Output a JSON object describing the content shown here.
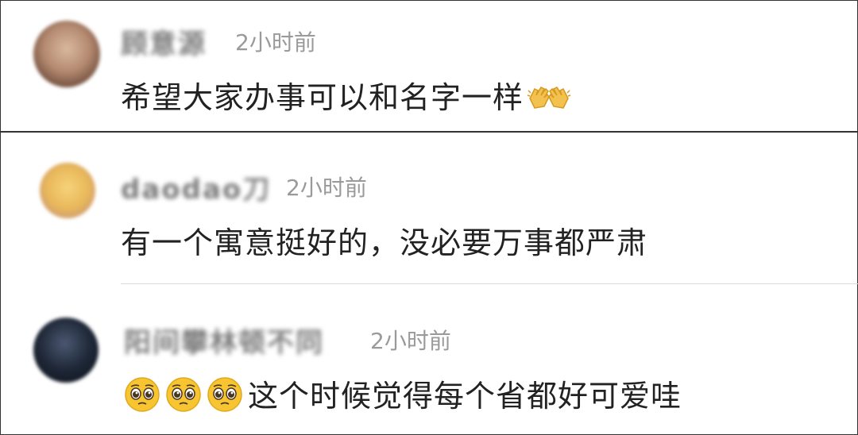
{
  "comments": [
    {
      "username": "顾意源",
      "time": "2小时前",
      "text": "希望大家办事可以和名字一样",
      "trailing_icon": "open-hands-icon"
    },
    {
      "username": "daodao刀",
      "time": "2小时前",
      "text": "有一个寓意挺好的，没必要万事都严肃"
    },
    {
      "username": "阳间攀林顿不同",
      "time": "2小时前",
      "leading_icons": [
        "pleading-face-icon",
        "pleading-face-icon",
        "pleading-face-icon"
      ],
      "text": "这个时候觉得每个省都好可爱哇"
    }
  ],
  "colors": {
    "time_gray": "#9a9a9a",
    "text": "#222222",
    "emoji_yellow": "#f7c531"
  }
}
